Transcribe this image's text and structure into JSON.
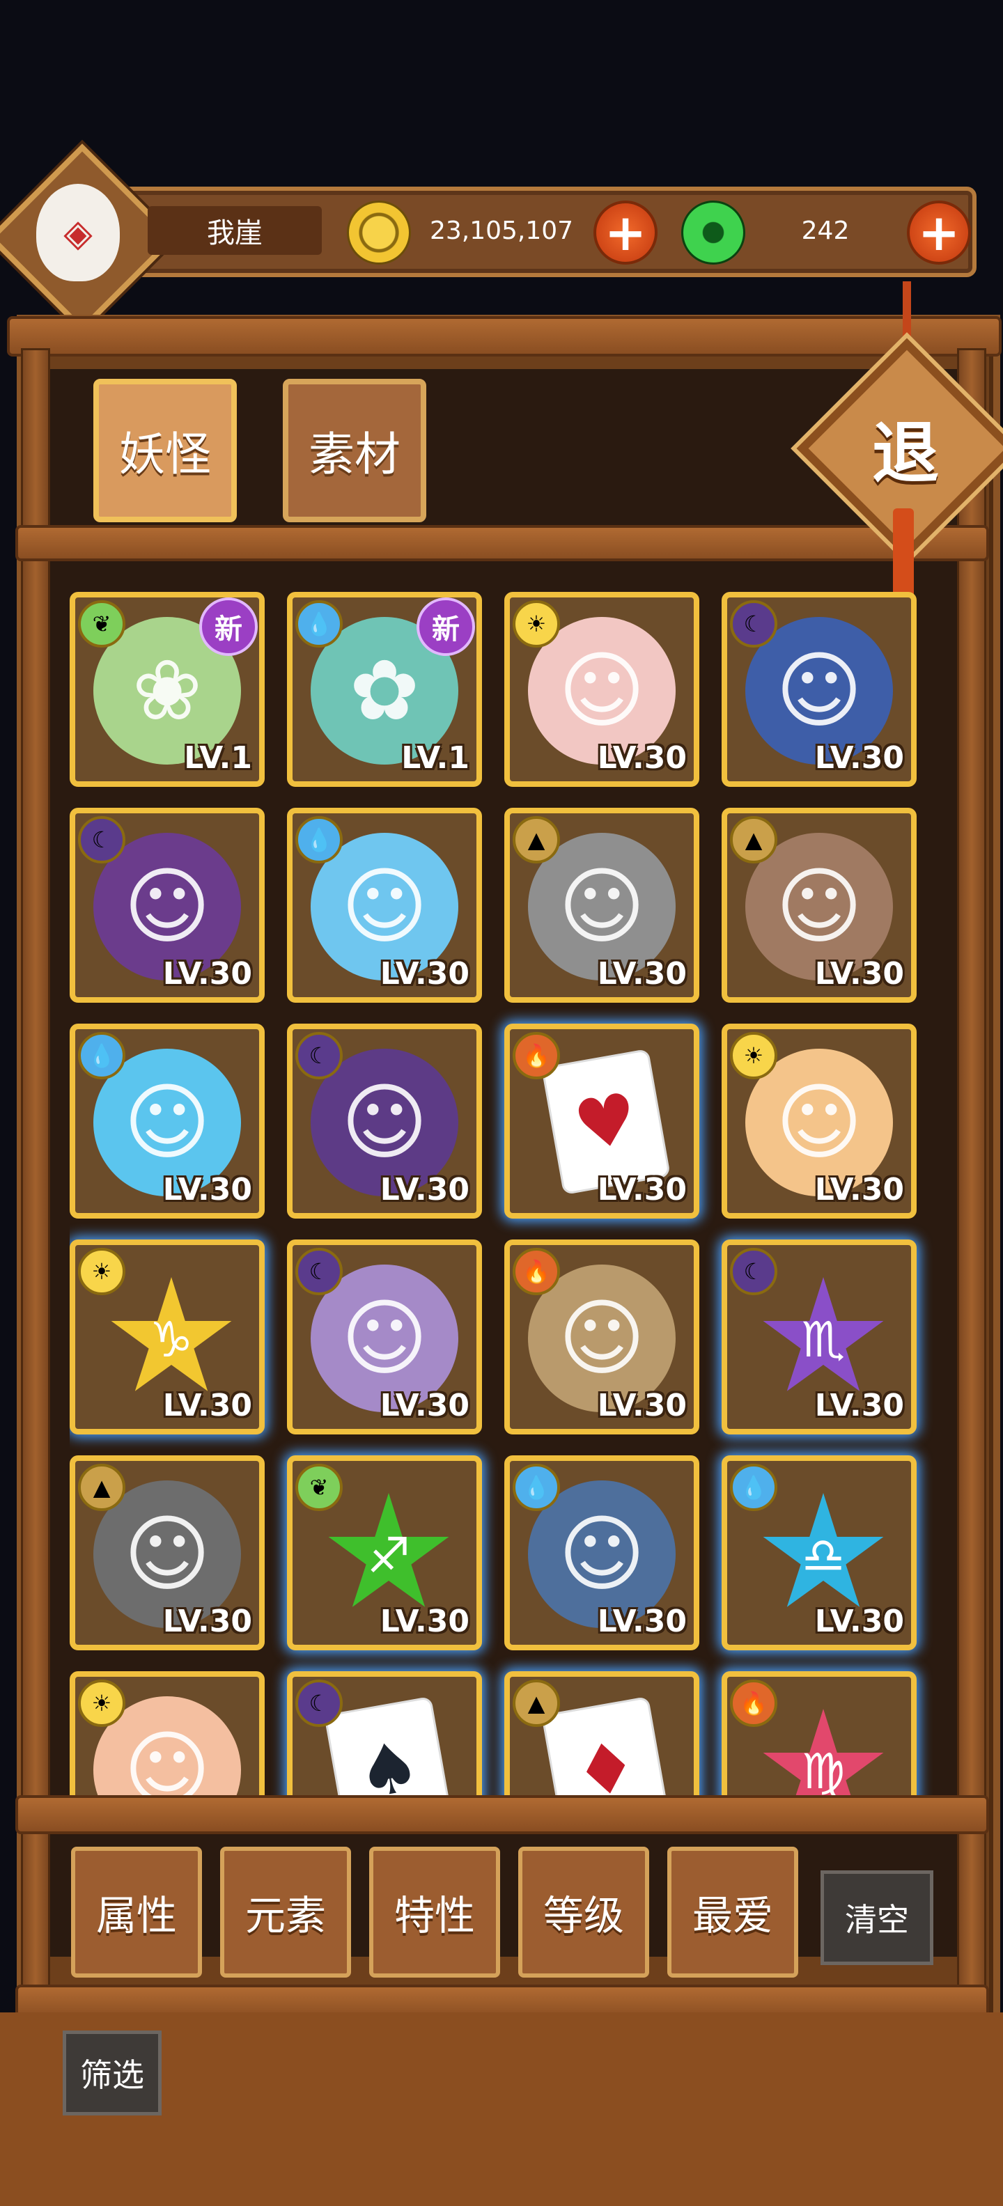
{
  "player": {
    "name": "我崖",
    "gold": "23,105,107",
    "gems": "242"
  },
  "tabs": [
    {
      "label": "妖怪",
      "active": true
    },
    {
      "label": "素材",
      "active": false
    }
  ],
  "exit_label": "退",
  "new_badge": "新",
  "cards": [
    {
      "level": "LV.1",
      "element": "leaf",
      "new": true,
      "color": "#a9d48c",
      "glyph": "❀"
    },
    {
      "level": "LV.1",
      "element": "water",
      "new": true,
      "color": "#6fc4b5",
      "glyph": "✿"
    },
    {
      "level": "LV.30",
      "element": "sun",
      "new": false,
      "color": "#f2c7c3",
      "glyph": "☺"
    },
    {
      "level": "LV.30",
      "element": "moon",
      "new": false,
      "color": "#3e5ea8",
      "glyph": "☺"
    },
    {
      "level": "LV.30",
      "element": "moon",
      "new": false,
      "color": "#6b3c8c",
      "glyph": "☺"
    },
    {
      "level": "LV.30",
      "element": "water",
      "new": false,
      "color": "#6fc6ef",
      "glyph": "☺"
    },
    {
      "level": "LV.30",
      "element": "earth",
      "new": false,
      "color": "#8f8f8f",
      "glyph": "☺"
    },
    {
      "level": "LV.30",
      "element": "earth",
      "new": false,
      "color": "#a07a62",
      "glyph": "☺"
    },
    {
      "level": "LV.30",
      "element": "water",
      "new": false,
      "color": "#5bc5ee",
      "glyph": "☺"
    },
    {
      "level": "LV.30",
      "element": "moon",
      "new": false,
      "color": "#5d3b86",
      "glyph": "☺"
    },
    {
      "level": "LV.30",
      "element": "fire",
      "new": false,
      "type": "card",
      "glyph": "♥"
    },
    {
      "level": "LV.30",
      "element": "sun",
      "new": false,
      "color": "#f4c48a",
      "glyph": "☺"
    },
    {
      "level": "LV.30",
      "element": "sun",
      "new": false,
      "type": "star",
      "color": "#f2c730",
      "glyph": "♑"
    },
    {
      "level": "LV.30",
      "element": "moon",
      "new": false,
      "color": "#a58ac8",
      "glyph": "☺"
    },
    {
      "level": "LV.30",
      "element": "fire",
      "new": false,
      "color": "#b99a6c",
      "glyph": "☺"
    },
    {
      "level": "LV.30",
      "element": "moon",
      "new": false,
      "type": "star",
      "color": "#8a4fc8",
      "glyph": "♏"
    },
    {
      "level": "LV.30",
      "element": "earth",
      "new": false,
      "color": "#6d6d6d",
      "glyph": "☺"
    },
    {
      "level": "LV.30",
      "element": "leaf",
      "new": false,
      "type": "star",
      "color": "#3fbf2c",
      "glyph": "♐"
    },
    {
      "level": "LV.30",
      "element": "water",
      "new": false,
      "color": "#4e6f9c",
      "glyph": "☺"
    },
    {
      "level": "LV.30",
      "element": "water",
      "new": false,
      "type": "star",
      "color": "#2fb4e1",
      "glyph": "♎"
    },
    {
      "level": "",
      "element": "sun",
      "new": false,
      "color": "#f4bfa0",
      "glyph": "☺"
    },
    {
      "level": "",
      "element": "moon",
      "new": false,
      "type": "card",
      "glyph": "♠"
    },
    {
      "level": "",
      "element": "earth",
      "new": false,
      "type": "card",
      "glyph": "♦"
    },
    {
      "level": "",
      "element": "fire",
      "new": false,
      "type": "star",
      "color": "#e2486c",
      "glyph": "♍"
    }
  ],
  "filters": [
    "属性",
    "元素",
    "特性",
    "等级",
    "最爱"
  ],
  "clear_label": "清空",
  "screen_label": "筛选",
  "colors": {
    "wood": "#7a4a26",
    "gold_border": "#f1c03e",
    "glow": "#4aa2ff",
    "plus": "#e25420"
  },
  "icons": {
    "gold": "gold-coin-icon",
    "gem": "green-gem-icon",
    "plus": "plus-icon",
    "elements": {
      "leaf": "leaf-icon",
      "water": "water-drop-icon",
      "sun": "sun-icon",
      "moon": "moon-icon",
      "earth": "mountain-icon",
      "fire": "fire-icon"
    }
  }
}
